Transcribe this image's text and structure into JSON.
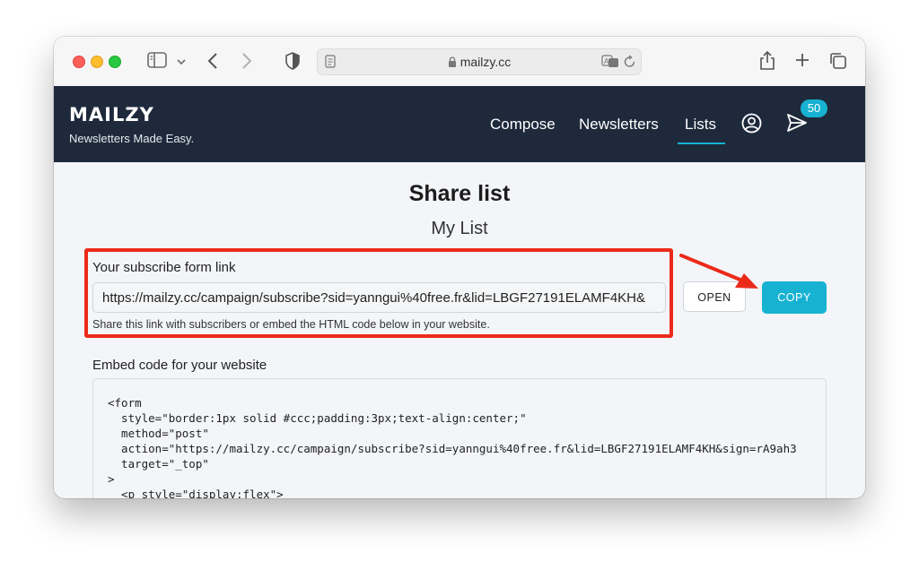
{
  "browser": {
    "url": "mailzy.cc"
  },
  "header": {
    "logo": "MAILZY",
    "tagline": "Newsletters Made Easy.",
    "nav": [
      {
        "label": "Compose"
      },
      {
        "label": "Newsletters"
      },
      {
        "label": "Lists",
        "active": true
      }
    ],
    "notification_count": "50",
    "accent_color": "#17b2d2",
    "bg_color": "#1e2a3c"
  },
  "page": {
    "title": "Share list",
    "list_name": "My List",
    "subscribe_label": "Your subscribe form link",
    "subscribe_link": "https://mailzy.cc/campaign/subscribe?sid=yanngui%40free.fr&lid=LBGF27191ELAMF4KH&",
    "help_text": "Share this link with subscribers or embed the HTML code below in your website.",
    "open_button": "OPEN",
    "copy_button": "COPY",
    "embed_label": "Embed code for your website",
    "embed_code": "<form\n  style=\"border:1px solid #ccc;padding:3px;text-align:center;\"\n  method=\"post\"\n  action=\"https://mailzy.cc/campaign/subscribe?sid=yanngui%40free.fr&lid=LBGF27191ELAMF4KH&sign=rA9ah3\n  target=\"_top\"\n>\n  <p style=\"display:flex\">"
  },
  "annotation": {
    "highlight_color": "#ec2a1a"
  }
}
